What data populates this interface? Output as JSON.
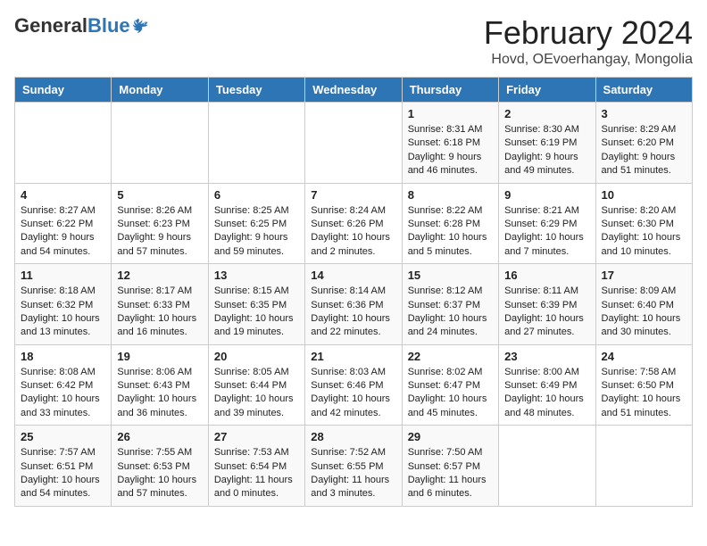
{
  "logo": {
    "general": "General",
    "blue": "Blue"
  },
  "title": "February 2024",
  "subtitle": "Hovd, OEvoerhangay, Mongolia",
  "days_of_week": [
    "Sunday",
    "Monday",
    "Tuesday",
    "Wednesday",
    "Thursday",
    "Friday",
    "Saturday"
  ],
  "weeks": [
    [
      {
        "day": "",
        "info": ""
      },
      {
        "day": "",
        "info": ""
      },
      {
        "day": "",
        "info": ""
      },
      {
        "day": "",
        "info": ""
      },
      {
        "day": "1",
        "info": "Sunrise: 8:31 AM\nSunset: 6:18 PM\nDaylight: 9 hours and 46 minutes."
      },
      {
        "day": "2",
        "info": "Sunrise: 8:30 AM\nSunset: 6:19 PM\nDaylight: 9 hours and 49 minutes."
      },
      {
        "day": "3",
        "info": "Sunrise: 8:29 AM\nSunset: 6:20 PM\nDaylight: 9 hours and 51 minutes."
      }
    ],
    [
      {
        "day": "4",
        "info": "Sunrise: 8:27 AM\nSunset: 6:22 PM\nDaylight: 9 hours and 54 minutes."
      },
      {
        "day": "5",
        "info": "Sunrise: 8:26 AM\nSunset: 6:23 PM\nDaylight: 9 hours and 57 minutes."
      },
      {
        "day": "6",
        "info": "Sunrise: 8:25 AM\nSunset: 6:25 PM\nDaylight: 9 hours and 59 minutes."
      },
      {
        "day": "7",
        "info": "Sunrise: 8:24 AM\nSunset: 6:26 PM\nDaylight: 10 hours and 2 minutes."
      },
      {
        "day": "8",
        "info": "Sunrise: 8:22 AM\nSunset: 6:28 PM\nDaylight: 10 hours and 5 minutes."
      },
      {
        "day": "9",
        "info": "Sunrise: 8:21 AM\nSunset: 6:29 PM\nDaylight: 10 hours and 7 minutes."
      },
      {
        "day": "10",
        "info": "Sunrise: 8:20 AM\nSunset: 6:30 PM\nDaylight: 10 hours and 10 minutes."
      }
    ],
    [
      {
        "day": "11",
        "info": "Sunrise: 8:18 AM\nSunset: 6:32 PM\nDaylight: 10 hours and 13 minutes."
      },
      {
        "day": "12",
        "info": "Sunrise: 8:17 AM\nSunset: 6:33 PM\nDaylight: 10 hours and 16 minutes."
      },
      {
        "day": "13",
        "info": "Sunrise: 8:15 AM\nSunset: 6:35 PM\nDaylight: 10 hours and 19 minutes."
      },
      {
        "day": "14",
        "info": "Sunrise: 8:14 AM\nSunset: 6:36 PM\nDaylight: 10 hours and 22 minutes."
      },
      {
        "day": "15",
        "info": "Sunrise: 8:12 AM\nSunset: 6:37 PM\nDaylight: 10 hours and 24 minutes."
      },
      {
        "day": "16",
        "info": "Sunrise: 8:11 AM\nSunset: 6:39 PM\nDaylight: 10 hours and 27 minutes."
      },
      {
        "day": "17",
        "info": "Sunrise: 8:09 AM\nSunset: 6:40 PM\nDaylight: 10 hours and 30 minutes."
      }
    ],
    [
      {
        "day": "18",
        "info": "Sunrise: 8:08 AM\nSunset: 6:42 PM\nDaylight: 10 hours and 33 minutes."
      },
      {
        "day": "19",
        "info": "Sunrise: 8:06 AM\nSunset: 6:43 PM\nDaylight: 10 hours and 36 minutes."
      },
      {
        "day": "20",
        "info": "Sunrise: 8:05 AM\nSunset: 6:44 PM\nDaylight: 10 hours and 39 minutes."
      },
      {
        "day": "21",
        "info": "Sunrise: 8:03 AM\nSunset: 6:46 PM\nDaylight: 10 hours and 42 minutes."
      },
      {
        "day": "22",
        "info": "Sunrise: 8:02 AM\nSunset: 6:47 PM\nDaylight: 10 hours and 45 minutes."
      },
      {
        "day": "23",
        "info": "Sunrise: 8:00 AM\nSunset: 6:49 PM\nDaylight: 10 hours and 48 minutes."
      },
      {
        "day": "24",
        "info": "Sunrise: 7:58 AM\nSunset: 6:50 PM\nDaylight: 10 hours and 51 minutes."
      }
    ],
    [
      {
        "day": "25",
        "info": "Sunrise: 7:57 AM\nSunset: 6:51 PM\nDaylight: 10 hours and 54 minutes."
      },
      {
        "day": "26",
        "info": "Sunrise: 7:55 AM\nSunset: 6:53 PM\nDaylight: 10 hours and 57 minutes."
      },
      {
        "day": "27",
        "info": "Sunrise: 7:53 AM\nSunset: 6:54 PM\nDaylight: 11 hours and 0 minutes."
      },
      {
        "day": "28",
        "info": "Sunrise: 7:52 AM\nSunset: 6:55 PM\nDaylight: 11 hours and 3 minutes."
      },
      {
        "day": "29",
        "info": "Sunrise: 7:50 AM\nSunset: 6:57 PM\nDaylight: 11 hours and 6 minutes."
      },
      {
        "day": "",
        "info": ""
      },
      {
        "day": "",
        "info": ""
      }
    ]
  ]
}
